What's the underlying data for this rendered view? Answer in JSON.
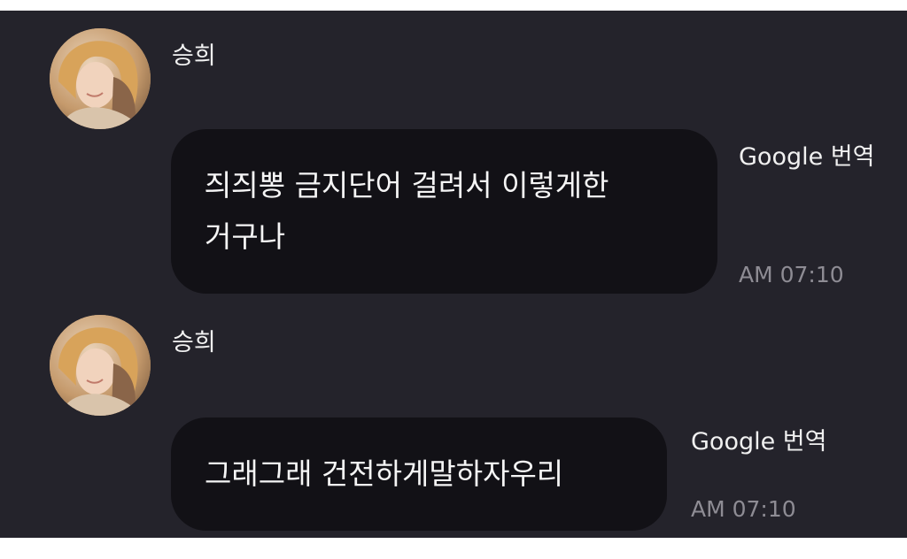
{
  "messages": [
    {
      "sender": "승희",
      "text": "즤즤뽕 금지단어 걸려서 이렇게한\n거구나",
      "translate_label": "Google 번역",
      "time": "AM 07:10"
    },
    {
      "sender": "승희",
      "text": "그래그래 건전하게말하자우리",
      "translate_label": "Google 번역",
      "time": "AM 07:10"
    }
  ],
  "colors": {
    "background": "#24232b",
    "bubble": "#121116",
    "text": "#f5f5f5",
    "timestamp": "#8e8c94"
  },
  "icons": {
    "avatar": "profile-photo"
  }
}
